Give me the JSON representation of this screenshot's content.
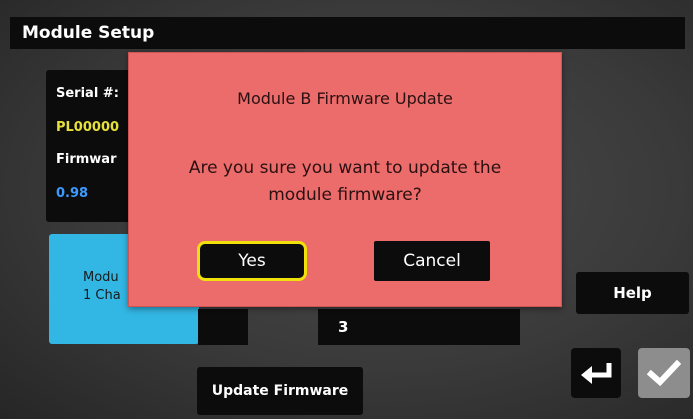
{
  "window": {
    "title": "Module Setup"
  },
  "info_panel": {
    "serial_label": "Serial #:",
    "serial_value": "PL00000",
    "firmware_label": "Firmwar",
    "firmware_value": "0.98"
  },
  "module_tile": {
    "line1": "Modu",
    "line2": "1 Cha"
  },
  "value_field": {
    "value": "3"
  },
  "buttons": {
    "help": "Help",
    "update_firmware": "Update Firmware"
  },
  "dialog": {
    "title": "Module B Firmware Update",
    "message_line1": "Are you sure you want to update the",
    "message_line2": "module firmware?",
    "yes_label": "Yes",
    "cancel_label": "Cancel"
  },
  "icons": {
    "back": "return-arrow-icon",
    "ok": "checkmark-icon"
  },
  "colors": {
    "dialog_background": "#ec6b6b",
    "focus_highlight": "#f0e10a",
    "module_tile": "#32b6e4",
    "serial_value": "#e6e03a",
    "firmware_value": "#3d9bff"
  }
}
